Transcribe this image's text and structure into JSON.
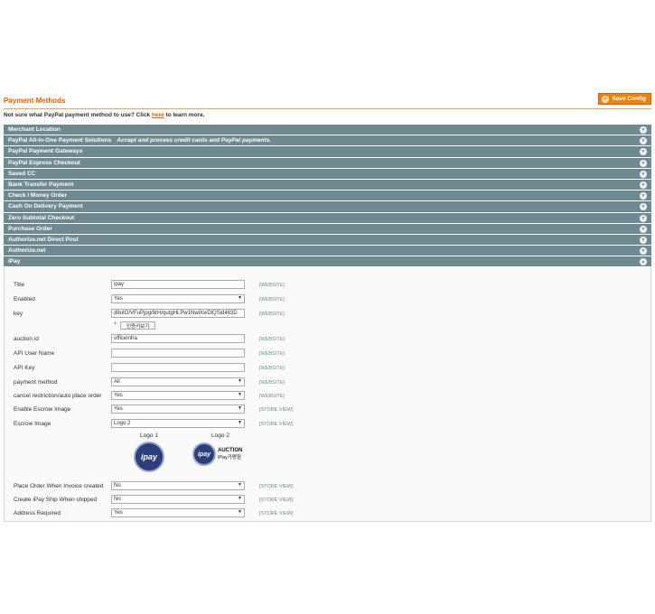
{
  "header": {
    "title": "Payment Methods",
    "save_label": "Save Config"
  },
  "notice": {
    "prefix": "Not sure what PayPal payment method to use? Click ",
    "link": "here",
    "suffix": " to learn more."
  },
  "sections": [
    {
      "label": "Merchant Location",
      "sub": ""
    },
    {
      "label": "PayPal All-in-One Payment Solutions",
      "sub": "Accept and process credit cards and PayPal payments."
    },
    {
      "label": "PayPal Payment Gateways",
      "sub": ""
    },
    {
      "label": "PayPal Express Checkout",
      "sub": ""
    },
    {
      "label": "Saved CC",
      "sub": ""
    },
    {
      "label": "Bank Transfer Payment",
      "sub": ""
    },
    {
      "label": "Check / Money Order",
      "sub": ""
    },
    {
      "label": "Cash On Delivery Payment",
      "sub": ""
    },
    {
      "label": "Zero Subtotal Checkout",
      "sub": ""
    },
    {
      "label": "Purchase Order",
      "sub": ""
    },
    {
      "label": "Authorize.net Direct Post",
      "sub": ""
    },
    {
      "label": "Authorize.net",
      "sub": ""
    }
  ],
  "ipay": {
    "section_label": "iPay",
    "fields": {
      "title": {
        "label": "Title",
        "value": "ipay",
        "scope": "[WEBSITE]"
      },
      "enabled": {
        "label": "Enabled",
        "value": "Yes",
        "scope": "[WEBSITE]"
      },
      "key": {
        "label": "key",
        "value": "d8uIO/VFuPjpg/8rH/qutgHLPw1NwlXwDlQSid463D",
        "scope": "[WEBSITE]",
        "show_button": "인증키보기"
      },
      "auction_id": {
        "label": "auction id",
        "value": "officeinfra",
        "scope": "[WEBSITE]"
      },
      "api_user_name": {
        "label": "API User Name",
        "value": "",
        "scope": "[WEBSITE]"
      },
      "api_key": {
        "label": "API Key",
        "value": "",
        "scope": "[WEBSITE]"
      },
      "payment_method": {
        "label": "payment method",
        "value": "All",
        "scope": "[WEBSITE]"
      },
      "cancel_restriction": {
        "label": "cancel restriction/auto place order",
        "value": "Yes",
        "scope": "[WEBSITE]"
      },
      "enable_escrow_image": {
        "label": "Enable Escrow Image",
        "value": "Yes",
        "scope": "[STORE VIEW]"
      },
      "escrow_image": {
        "label": "Escrow Image",
        "value": "Logo 2",
        "scope": "[STORE VIEW]"
      },
      "place_order_invoice": {
        "label": "Place Order When Invoice created",
        "value": "No",
        "scope": "[STORE VIEW]"
      },
      "create_ship": {
        "label": "Create iPay Ship When shipped",
        "value": "No",
        "scope": "[STORE VIEW]"
      },
      "address_required": {
        "label": "Address Required",
        "value": "Yes",
        "scope": "[STORE VIEW]"
      }
    },
    "logos": {
      "logo1_caption": "Logo 1",
      "logo2_caption": "Logo 2",
      "logo_text": "ipay",
      "logo2_t1": "AUCTION",
      "logo2_t2": "iPay가맹점"
    }
  },
  "colors": {
    "accent": "#eb5e00",
    "section_bar": "#6f8992",
    "button": "#f18200"
  }
}
